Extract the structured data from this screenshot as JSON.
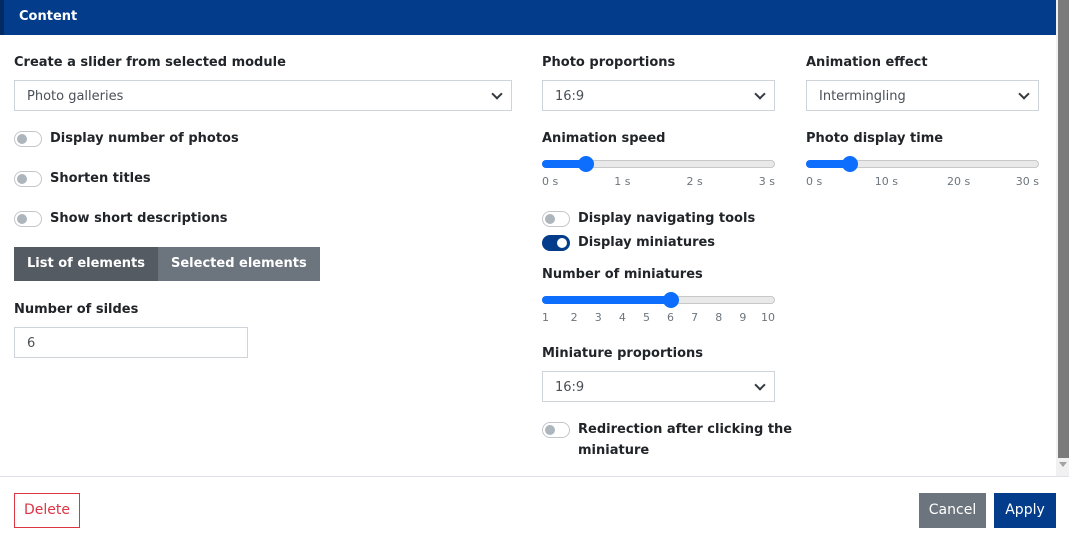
{
  "header": {
    "title": "Content"
  },
  "left": {
    "module_label": "Create a slider from selected module",
    "module_value": "Photo galleries",
    "toggles": [
      {
        "label": "Display number of photos",
        "on": false
      },
      {
        "label": "Shorten titles",
        "on": false
      },
      {
        "label": "Show short descriptions",
        "on": false
      }
    ],
    "tabs": [
      {
        "label": "List of elements",
        "active": true
      },
      {
        "label": "Selected elements",
        "active": false
      }
    ],
    "slides_label": "Number of sildes",
    "slides_value": "6"
  },
  "middle": {
    "photo_proportions_label": "Photo proportions",
    "photo_proportions_value": "16:9",
    "animation_speed_label": "Animation speed",
    "animation_speed": {
      "min": 0,
      "max": 3,
      "value": 0.5,
      "ticks": [
        "0 s",
        "1 s",
        "2 s",
        "3 s"
      ]
    },
    "nav_tools": {
      "label": "Display navigating tools",
      "on": false
    },
    "miniatures": {
      "label": "Display miniatures",
      "on": true
    },
    "num_miniatures_label": "Number of miniatures",
    "num_miniatures": {
      "min": 1,
      "max": 10,
      "value": 6,
      "ticks": [
        "1",
        "2",
        "3",
        "4",
        "5",
        "6",
        "7",
        "8",
        "9",
        "10"
      ]
    },
    "mini_proportions_label": "Miniature proportions",
    "mini_proportions_value": "16:9",
    "redirection": {
      "label_line1": "Redirection after clicking the",
      "label_line2": "miniature",
      "on": false
    }
  },
  "right": {
    "animation_effect_label": "Animation effect",
    "animation_effect_value": "Intermingling",
    "display_time_label": "Photo display time",
    "display_time": {
      "min": 0,
      "max": 30,
      "value": 5,
      "ticks": [
        "0 s",
        "10 s",
        "20 s",
        "30 s"
      ]
    }
  },
  "footer": {
    "delete": "Delete",
    "cancel": "Cancel",
    "apply": "Apply"
  },
  "colors": {
    "primary": "#033c8a",
    "slider": "#0d6efd",
    "danger": "#dc3545",
    "secondary": "#6c757d"
  }
}
